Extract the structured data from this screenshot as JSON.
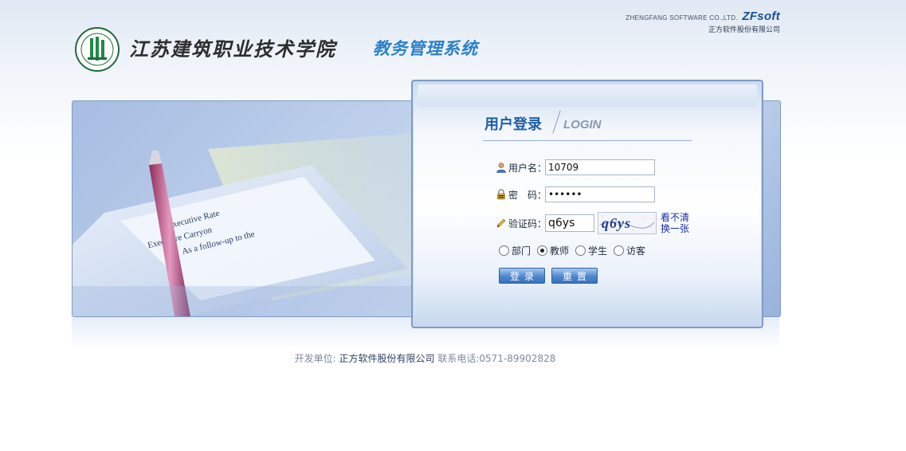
{
  "vendor": {
    "english_name": "ZHENGFANG SOFTWARE CO.,LTD.",
    "brand": "ZFsoft",
    "chinese_name": "正方软件股份有限公司"
  },
  "header": {
    "school_name": "江苏建筑职业技术学院",
    "system_name": "教务管理系统"
  },
  "banner": {
    "paper_line1": "Executive Rate",
    "paper_line2": "Executive Carryon",
    "paper_line3": "As a follow-up to the"
  },
  "login": {
    "title": "用户登录",
    "subtitle": "LOGIN",
    "username_label": "用户名：",
    "username_value": "10709",
    "password_label": "密　码：",
    "password_value": "••••••",
    "captcha_label": "验证码：",
    "captcha_value": "q6ys",
    "captcha_image_text": "q6ys",
    "captcha_refresh": "看不清换一张",
    "roles": [
      {
        "label": "部门",
        "checked": false
      },
      {
        "label": "教师",
        "checked": true
      },
      {
        "label": "学生",
        "checked": false
      },
      {
        "label": "访客",
        "checked": false
      }
    ],
    "login_button": "登录",
    "reset_button": "重置"
  },
  "footer": {
    "developer_label": "开发单位:",
    "developer_name": "正方软件股份有限公司",
    "contact_label": "联系电话:",
    "contact_phone": "0571-89902828"
  },
  "colors": {
    "accent_blue": "#2b80c8",
    "title_blue": "#1f5ea8",
    "button_blue": "#4f86cc"
  }
}
